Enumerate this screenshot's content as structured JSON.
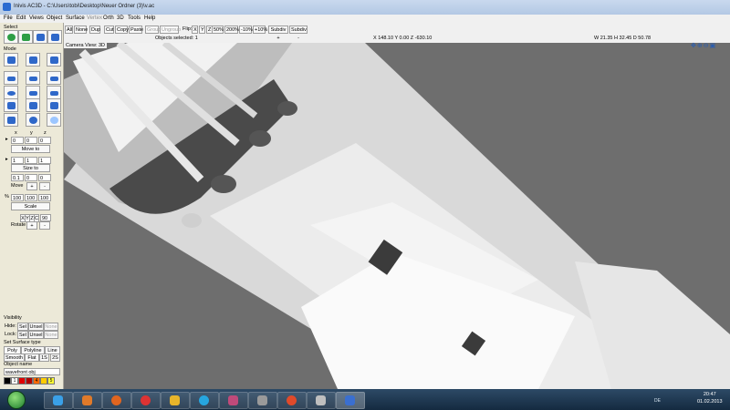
{
  "window": {
    "title": "Inivis AC3D - C:\\Users\\tobi\\Desktop\\Neuer Ordner (3)\\v.ac"
  },
  "menu": [
    "File",
    "Edit",
    "Views",
    "Object",
    "Surface",
    "Vertex",
    "Orth",
    "3D",
    "Tools",
    "Help"
  ],
  "toolbar": {
    "select_all": "All",
    "select_none": "None",
    "dup": "Dup",
    "cut": "Cut",
    "copy": "Copy",
    "paste": "Paste",
    "group": "Group",
    "ungroup": "Ungroup",
    "flip_label": "Flip:",
    "flip_x": "X",
    "flip_y": "Y",
    "flip_z": "Z",
    "scale_50": "50%",
    "scale_200": "200%",
    "scale_minus10": "-10%",
    "scale_plus10": "+10%",
    "subdiv_plus": "Subdiv +",
    "subdiv_minus": "Subdiv -",
    "objects_selected": "Objects selected: 1",
    "coords": "X 148.10 Y 0.00 Z -630.10",
    "dims": "W 21.35 H 32.45 D 50.78"
  },
  "viewport": {
    "label_camera": "Camera",
    "label_view": "View: 3D",
    "bg": "#6e6e6e"
  },
  "panel": {
    "select_title": "Select",
    "mode_title": "Mode",
    "xyz_labels": [
      "x",
      "y",
      "z"
    ],
    "move_vals": [
      "0",
      "0",
      "0"
    ],
    "move_to": "Move to",
    "size_vals": [
      "1",
      "1",
      "1"
    ],
    "size_to": "Size to",
    "step_vals": [
      "0.1",
      "0",
      "0"
    ],
    "move_label": "Move",
    "plus": "+",
    "minus": "-",
    "scale_pct": "%",
    "scale_vals": [
      "100",
      "100",
      "100"
    ],
    "scale_btn": "Scale",
    "rot_axes": [
      "X",
      "Y",
      "Z",
      "C"
    ],
    "rot_value": "90",
    "rotate_label": "Rotate",
    "visibility_title": "Visibility",
    "hide": "Hide:",
    "lock": "Lock:",
    "sel": "Sel",
    "unsel": "Unsel",
    "none": "None",
    "surface_title": "Set Surface type",
    "poly": "Poly",
    "polyline": "Polyline",
    "line": "Line",
    "smooth": "Smooth",
    "flat": "Flat",
    "one_s": "1S",
    "two_s": "2S",
    "objname_title": "Object name",
    "objname_value": "wavefront obj",
    "palette_num": "1",
    "palette_nums": [
      "4",
      "5"
    ],
    "colors": [
      "#000000",
      "#ffffff",
      "#e00000",
      "#ff6a00",
      "#ffcc00",
      "#ffff33"
    ]
  },
  "taskbar": {
    "lang": "DE",
    "time": "20:47",
    "date": "01.02.2013"
  }
}
